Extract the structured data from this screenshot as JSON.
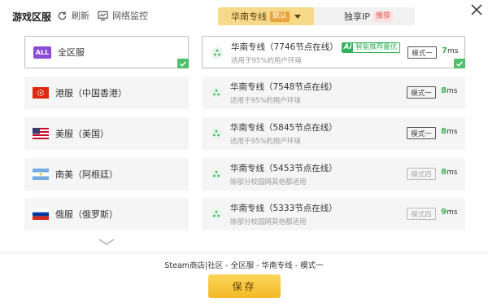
{
  "header": {
    "title": "游戏区服",
    "refresh_label": "刷新",
    "network_label": "网络监控",
    "tab_south_label": "华南专线",
    "tab_south_badge": "默认",
    "tab_ip_label": "独享IP",
    "tab_ip_badge": "推荐"
  },
  "regions": [
    {
      "label": "全区服",
      "icon": "all-icon",
      "tag": "ALL",
      "selected": true
    },
    {
      "label": "港服（中国香港）",
      "icon": "hong-kong-flag-icon",
      "selected": false
    },
    {
      "label": "美服（美国）",
      "icon": "usa-flag-icon",
      "selected": false
    },
    {
      "label": "南美（阿根廷）",
      "icon": "argentina-flag-icon",
      "selected": false
    },
    {
      "label": "俄服（俄罗斯）",
      "icon": "russia-flag-icon",
      "selected": false
    }
  ],
  "nodes": [
    {
      "name": "华南专线（7746节点在线）",
      "ai_tag": "Ai",
      "ai_text": "智能推荐最优",
      "sub": "适用于95%的用户环境",
      "mode": "模式一",
      "ping": "7",
      "unit": "ms",
      "selected": true,
      "dim": false
    },
    {
      "name": "华南专线（7548节点在线）",
      "sub": "适用于95%的用户环境",
      "mode": "模式一",
      "ping": "8",
      "unit": "ms",
      "selected": false,
      "dim": false
    },
    {
      "name": "华南专线（5845节点在线）",
      "sub": "适用于95%的用户环境",
      "mode": "模式一",
      "ping": "8",
      "unit": "ms",
      "selected": false,
      "dim": false
    },
    {
      "name": "华南专线（5453节点在线）",
      "sub": "除部分校园网其他都适用",
      "mode": "模式四",
      "ping": "8",
      "unit": "ms",
      "selected": false,
      "dim": true
    },
    {
      "name": "华南专线（5333节点在线）",
      "sub": "除部分校园网其他都适用",
      "mode": "模式四",
      "ping": "9",
      "unit": "ms",
      "selected": false,
      "dim": true
    }
  ],
  "footer": {
    "summary": "Steam商店|社区 - 全区服 - 华南专线 - 模式一",
    "save_label": "保存"
  },
  "colors": {
    "accent_gold": "#f7d98a",
    "save_button": "#f3b927",
    "ping_green": "#3cb555",
    "check_green": "#4cc16a",
    "all_tag_purple": "#8a4bd6"
  }
}
